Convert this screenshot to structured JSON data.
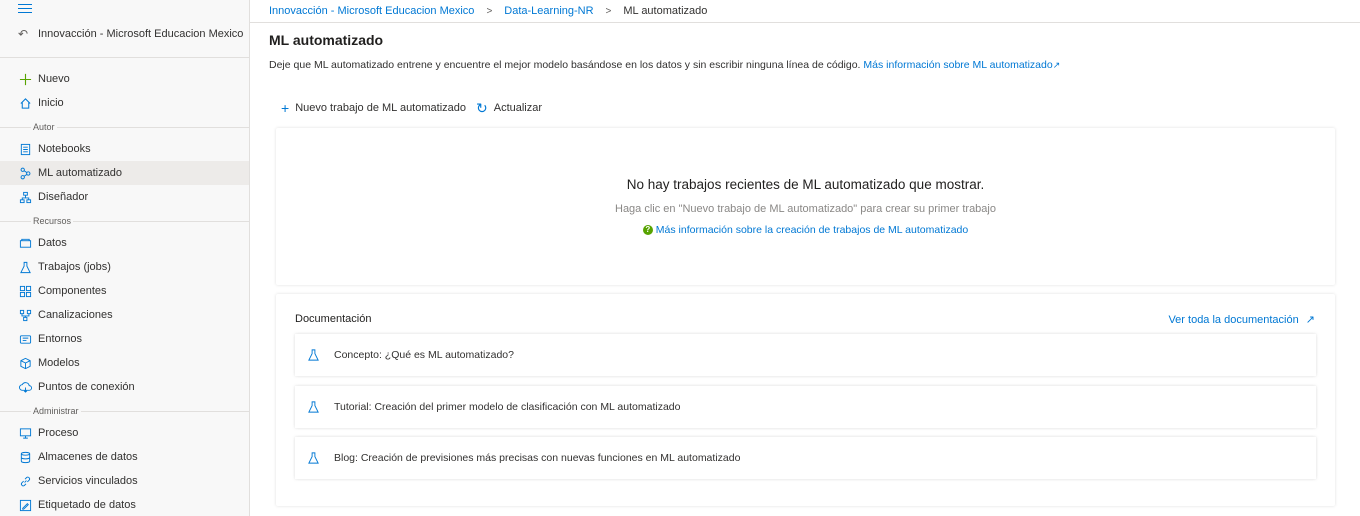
{
  "sidebar": {
    "workspace_label": "Innovacción - Microsoft Educacion Mexico",
    "top_items": [
      {
        "label": "Nuevo",
        "icon": "plus-icon"
      },
      {
        "label": "Inicio",
        "icon": "home-icon"
      }
    ],
    "sections": [
      {
        "label": "Autor"
      },
      {
        "label": "Recursos"
      },
      {
        "label": "Administrar"
      }
    ],
    "author_items": [
      {
        "label": "Notebooks",
        "icon": "notebook-icon"
      },
      {
        "label": "ML automatizado",
        "icon": "automl-icon",
        "active": true
      },
      {
        "label": "Diseñador",
        "icon": "designer-icon"
      }
    ],
    "resource_items": [
      {
        "label": "Datos",
        "icon": "data-icon"
      },
      {
        "label": "Trabajos (jobs)",
        "icon": "flask-icon"
      },
      {
        "label": "Componentes",
        "icon": "components-icon"
      },
      {
        "label": "Canalizaciones",
        "icon": "pipeline-icon"
      },
      {
        "label": "Entornos",
        "icon": "environment-icon"
      },
      {
        "label": "Modelos",
        "icon": "model-icon"
      },
      {
        "label": "Puntos de conexión",
        "icon": "endpoint-icon"
      }
    ],
    "admin_items": [
      {
        "label": "Proceso",
        "icon": "compute-icon"
      },
      {
        "label": "Almacenes de datos",
        "icon": "datastore-icon"
      },
      {
        "label": "Servicios vinculados",
        "icon": "link-icon"
      },
      {
        "label": "Etiquetado de datos",
        "icon": "labeling-icon"
      }
    ]
  },
  "breadcrumb": {
    "items": [
      "Innovacción - Microsoft Educacion Mexico",
      "Data-Learning-NR",
      "ML automatizado"
    ]
  },
  "header": {
    "title": "ML automatizado",
    "description": "Deje que ML automatizado entrene y encuentre el mejor modelo basándose en los datos y sin escribir ninguna línea de código.",
    "learn_more": "Más información sobre ML automatizado"
  },
  "toolbar": {
    "new_job": "Nuevo trabajo de ML automatizado",
    "refresh": "Actualizar"
  },
  "empty_state": {
    "title": "No hay trabajos recientes de ML automatizado que mostrar.",
    "subtitle": "Haga clic en \"Nuevo trabajo de ML automatizado\" para crear su primer trabajo",
    "link": "Más información sobre la creación de trabajos de ML automatizado"
  },
  "docs": {
    "title": "Documentación",
    "view_all": "Ver toda la documentación",
    "items": [
      {
        "label": "Concepto: ¿Qué es ML automatizado?"
      },
      {
        "label": "Tutorial: Creación del primer modelo de clasificación con ML automatizado"
      },
      {
        "label": "Blog: Creación de previsiones más precisas con nuevas funciones en ML automatizado"
      }
    ]
  },
  "colors": {
    "accent": "#0078d4",
    "sidebar_bg": "#f8f8f8",
    "active_bg": "#edebe9",
    "help_green": "#57a300"
  }
}
